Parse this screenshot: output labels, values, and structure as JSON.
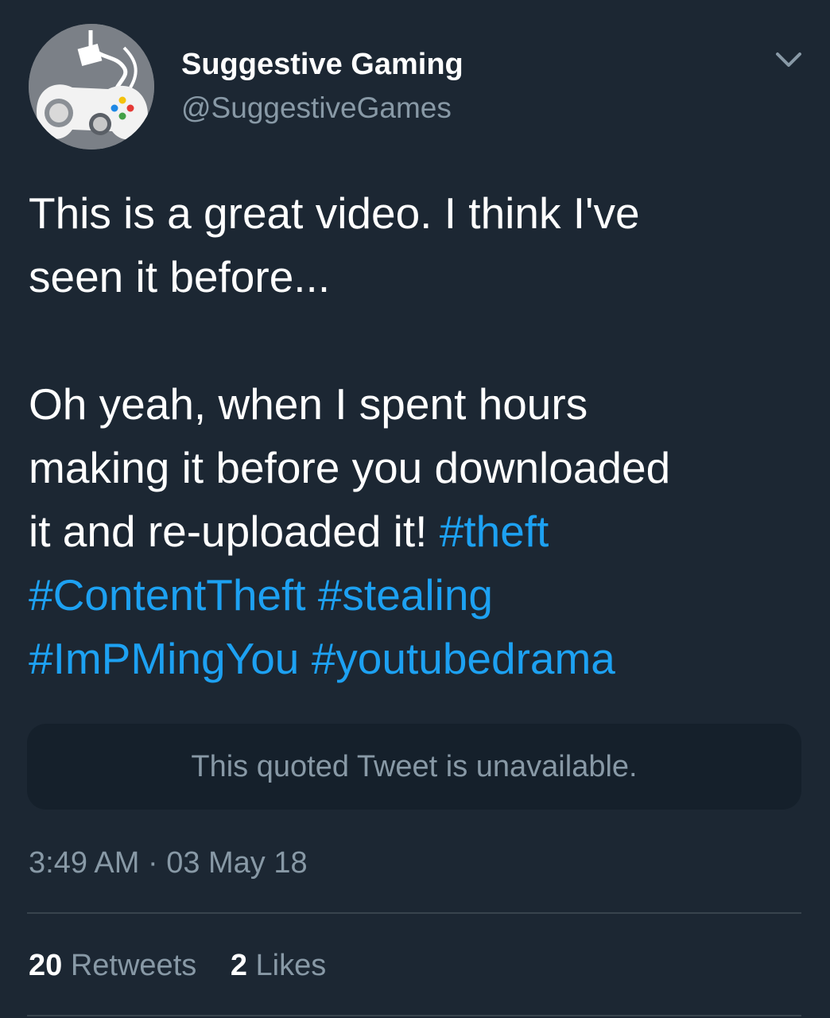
{
  "author": {
    "display_name": "Suggestive Gaming",
    "handle": "@SuggestiveGames",
    "avatar_icon": "game-controller-avatar"
  },
  "menu_icon": "chevron-down-icon",
  "tweet": {
    "line1": "This is a great video. I think I've",
    "line2": "seen it before...",
    "line3": "Oh yeah, when I spent hours",
    "line4": "making it before you downloaded",
    "line5_text": "it and re-uploaded it! ",
    "hashtags": [
      "#theft",
      "#ContentTheft",
      "#stealing",
      "#ImPMingYou",
      "#youtubedrama"
    ]
  },
  "quoted_tweet": {
    "message": "This quoted Tweet is unavailable."
  },
  "timestamp": "3:49 AM · 03 May 18",
  "stats": {
    "retweets_count": "20",
    "retweets_label": "Retweets",
    "likes_count": "2",
    "likes_label": "Likes"
  },
  "colors": {
    "background": "#1c2733",
    "hashtag": "#1da1f2",
    "secondary_text": "#8899a6"
  }
}
